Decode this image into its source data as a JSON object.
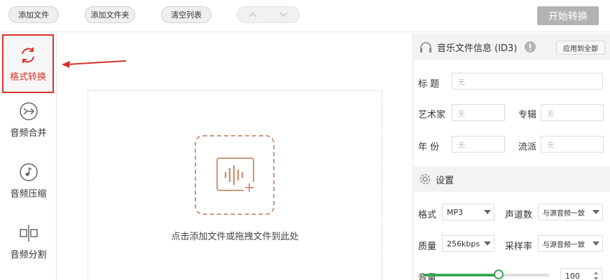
{
  "toolbar": {
    "add_file": "添加文件",
    "add_folder": "添加文件夹",
    "clear_list": "清空列表",
    "start": "开始转换"
  },
  "sidebar": {
    "items": [
      {
        "label": "格式转换",
        "icon": "refresh-icon",
        "active": true
      },
      {
        "label": "音频合并",
        "icon": "merge-icon"
      },
      {
        "label": "音频压缩",
        "icon": "music-note-icon"
      },
      {
        "label": "音频分割",
        "icon": "split-icon"
      }
    ]
  },
  "dropzone": {
    "text": "点击添加文件或拖拽文件到此处"
  },
  "id3": {
    "title": "音乐文件信息 (ID3)",
    "apply_all": "应用到全部",
    "fields": {
      "title_label": "标  题",
      "title_placeholder": "无",
      "artist_label": "艺术家",
      "artist_placeholder": "无",
      "album_label": "专辑",
      "album_placeholder": "无",
      "year_label": "年  份",
      "year_placeholder": "无",
      "genre_label": "流派",
      "genre_placeholder": "无"
    }
  },
  "settings": {
    "title": "设置",
    "format_label": "格式",
    "format_value": "MP3",
    "channel_label": "声道数",
    "channel_value": "与源音频一致",
    "quality_label": "质量",
    "quality_value": "256kbps",
    "samplerate_label": "采样率",
    "samplerate_value": "与源音频一致",
    "volume_label": "音量",
    "volume_value": "100",
    "volume_fraction": 0.6
  },
  "colors": {
    "accent_red": "#d9312a",
    "slider_green": "#3aa657",
    "upload_brown": "#c9977d"
  }
}
